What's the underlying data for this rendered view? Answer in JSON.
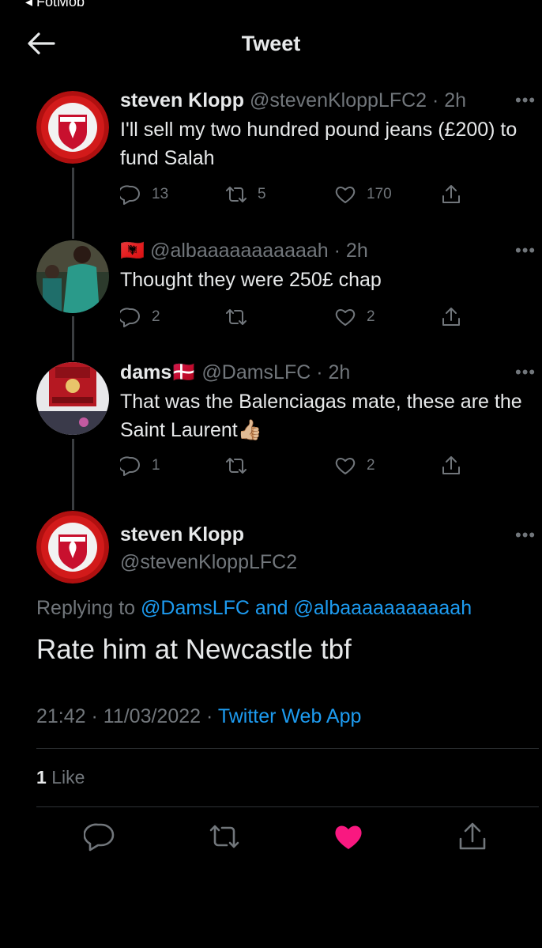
{
  "status_app": "◂ FotMob",
  "header": {
    "title": "Tweet"
  },
  "thread": [
    {
      "name": "steven Klopp",
      "handle": "@stevenKloppLFC2",
      "time": "· 2h",
      "text": "I'll sell my two hundred pound jeans (£200) to fund Salah",
      "replies": "13",
      "retweets": "5",
      "likes": "170"
    },
    {
      "name": "🇦🇱",
      "handle": "@albaaaaaaaaaaah",
      "time": "· 2h",
      "text": "Thought they were 250£ chap",
      "replies": "2",
      "retweets": "",
      "likes": "2"
    },
    {
      "name": "dams🇩🇰",
      "handle": "@DamsLFC",
      "time": "· 2h",
      "text": "That was the Balenciagas mate, these are the Saint Laurent👍🏼",
      "replies": "1",
      "retweets": "",
      "likes": "2"
    }
  ],
  "main": {
    "name": "steven Klopp",
    "handle": "@stevenKloppLFC2",
    "replying_prefix": "Replying to",
    "replying_targets": "@DamsLFC and @albaaaaaaaaaaah",
    "text": "Rate him at Newcastle tbf",
    "timestamp": "21:42 · 11/03/2022 ·",
    "source": "Twitter Web App",
    "like_count": "1",
    "like_label": "Like"
  },
  "icons": {
    "more": "more-dots-icon",
    "reply": "reply-bubble-icon",
    "retweet": "retweet-icon",
    "like": "heart-icon",
    "share": "share-icon",
    "liked_color": "#f91880",
    "link_color": "#1d9bf0"
  }
}
